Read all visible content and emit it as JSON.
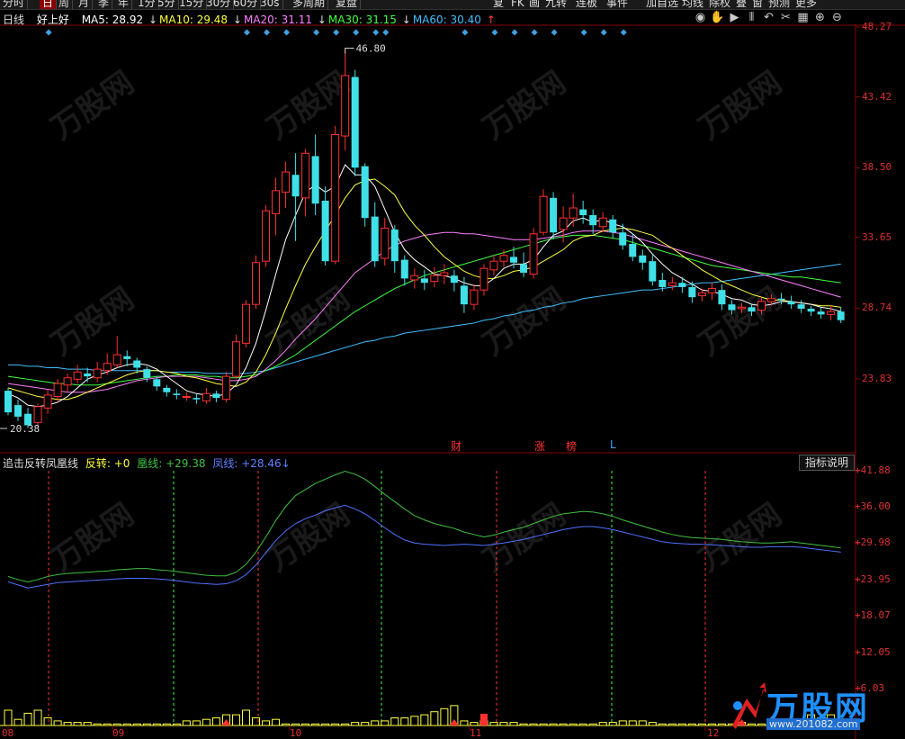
{
  "toolbar": {
    "items": [
      "分时",
      "日",
      "周",
      "月",
      "季",
      "年",
      "1分",
      "5分",
      "15分",
      "30分",
      "60分",
      "30s",
      "多周期",
      "复盘"
    ],
    "active_index": 1,
    "right_items": [
      "复",
      "FK",
      "画",
      "九转",
      "连板",
      "事件",
      "加自选",
      "均线",
      "除权",
      "叠",
      "窗",
      "预测",
      "更多"
    ]
  },
  "legend": {
    "period": "日线",
    "stock_name": "好上好",
    "ma5": "MA5: 28.92",
    "ma10": "MA10: 29.48",
    "ma20": "MA20: 31.11",
    "ma30": "MA30: 31.15",
    "ma60": "MA60: 30.40",
    "colors": {
      "ma5": "#ffffff",
      "ma10": "#ffff40",
      "ma20": "#ff80ff",
      "ma30": "#40ff40",
      "ma60": "#40c0ff"
    }
  },
  "icons": [
    "eye-icon",
    "hand-icon",
    "play-icon",
    "split-icon",
    "undo-icon",
    "scissors-icon",
    "calendar-icon",
    "zoom-in-icon",
    "zoom-out-icon"
  ],
  "price_axis": [
    "48.27",
    "43.42",
    "38.50",
    "33.65",
    "28.74",
    "23.83"
  ],
  "annotations": {
    "high": "46.80",
    "low": "20.38"
  },
  "events": [
    {
      "label": "财",
      "color": "#ff3030"
    },
    {
      "label": "涨",
      "color": "#ff3030"
    },
    {
      "label": "榜",
      "color": "#ff3030"
    },
    {
      "label": "L",
      "color": "#40a0ff"
    }
  ],
  "indicator": {
    "name": "追击反转凤凰线",
    "fanzhuan": "反转: +0",
    "huang": "凰线: +29.38",
    "feng": "凤线: +28.46",
    "button": "指标说明",
    "axis": [
      "+41.88",
      "+36.00",
      "+29.98",
      "+23.95",
      "+18.07",
      "+12.05",
      "+6.03"
    ]
  },
  "x_axis": [
    "08",
    "09",
    "10",
    "11",
    "12"
  ],
  "watermark": {
    "text": "万股网",
    "url": "www.201082.com"
  },
  "chart_data": {
    "type": "candlestick",
    "y_range": [
      20.38,
      48.27
    ],
    "high_marker": 46.8,
    "low_marker": 20.38,
    "candles": [
      [
        23.0,
        21.5,
        23.2,
        21.3
      ],
      [
        22.0,
        21.2,
        22.4,
        20.9
      ],
      [
        21.4,
        20.6,
        21.8,
        20.4
      ],
      [
        20.8,
        21.9,
        22.1,
        20.5
      ],
      [
        21.8,
        22.7,
        23.1,
        21.4
      ],
      [
        22.6,
        23.5,
        23.8,
        22.2
      ],
      [
        23.4,
        23.9,
        24.2,
        22.9
      ],
      [
        23.8,
        24.3,
        24.8,
        23.5
      ],
      [
        24.2,
        24.0,
        24.6,
        23.6
      ],
      [
        23.9,
        24.5,
        25.0,
        23.6
      ],
      [
        24.4,
        24.9,
        25.6,
        24.1
      ],
      [
        24.8,
        25.5,
        26.8,
        24.6
      ],
      [
        25.4,
        25.2,
        25.8,
        24.7
      ],
      [
        25.1,
        24.6,
        25.3,
        24.2
      ],
      [
        24.5,
        23.9,
        24.7,
        23.6
      ],
      [
        23.8,
        23.3,
        24.0,
        23.0
      ],
      [
        23.2,
        22.9,
        23.4,
        22.6
      ],
      [
        22.8,
        22.7,
        23.1,
        22.4
      ],
      [
        22.6,
        22.6,
        22.9,
        22.3
      ],
      [
        22.5,
        22.4,
        22.8,
        22.1
      ],
      [
        22.3,
        22.8,
        23.2,
        22.1
      ],
      [
        22.8,
        22.5,
        23.0,
        22.2
      ],
      [
        22.4,
        24.0,
        24.3,
        22.2
      ],
      [
        24.0,
        26.4,
        26.9,
        23.8
      ],
      [
        26.3,
        29.0,
        29.3,
        26.0
      ],
      [
        29.0,
        31.9,
        32.4,
        28.7
      ],
      [
        32.0,
        35.5,
        35.9,
        31.6
      ],
      [
        35.3,
        36.9,
        37.8,
        33.8
      ],
      [
        36.8,
        38.2,
        38.9,
        35.7
      ],
      [
        38.0,
        36.5,
        39.5,
        33.4
      ],
      [
        36.4,
        39.5,
        39.8,
        35.1
      ],
      [
        39.3,
        36.0,
        40.8,
        35.2
      ],
      [
        36.2,
        32.0,
        37.2,
        31.7
      ],
      [
        32.0,
        40.8,
        41.4,
        31.8
      ],
      [
        40.7,
        44.9,
        46.8,
        39.7
      ],
      [
        44.8,
        38.5,
        45.3,
        37.9
      ],
      [
        38.6,
        35.0,
        38.8,
        34.4
      ],
      [
        35.1,
        32.0,
        36.1,
        31.6
      ],
      [
        32.2,
        34.3,
        35.0,
        31.7
      ],
      [
        34.2,
        32.0,
        34.5,
        31.2
      ],
      [
        32.1,
        30.8,
        32.4,
        30.3
      ],
      [
        30.7,
        31.0,
        31.5,
        30.1
      ],
      [
        30.8,
        30.5,
        31.4,
        30.0
      ],
      [
        30.6,
        31.0,
        31.6,
        30.2
      ],
      [
        31.0,
        31.2,
        31.8,
        30.4
      ],
      [
        31.0,
        30.5,
        31.4,
        29.9
      ],
      [
        30.3,
        29.0,
        30.9,
        28.4
      ],
      [
        29.0,
        30.0,
        30.4,
        28.6
      ],
      [
        30.0,
        31.5,
        31.8,
        29.6
      ],
      [
        31.4,
        32.0,
        32.4,
        31.0
      ],
      [
        32.0,
        32.4,
        32.8,
        31.6
      ],
      [
        32.3,
        31.9,
        33.0,
        31.5
      ],
      [
        31.8,
        31.2,
        32.6,
        30.9
      ],
      [
        31.1,
        33.9,
        34.3,
        30.8
      ],
      [
        34.0,
        36.5,
        37.0,
        33.8
      ],
      [
        36.4,
        34.0,
        36.8,
        33.5
      ],
      [
        34.2,
        35.0,
        35.8,
        33.3
      ],
      [
        35.0,
        35.7,
        36.7,
        34.4
      ],
      [
        35.6,
        35.2,
        36.2,
        34.6
      ],
      [
        35.2,
        34.5,
        35.6,
        33.9
      ],
      [
        34.4,
        35.0,
        35.4,
        34.0
      ],
      [
        34.9,
        34.0,
        35.2,
        33.6
      ],
      [
        34.0,
        33.1,
        34.6,
        32.8
      ],
      [
        33.2,
        32.3,
        33.9,
        32.0
      ],
      [
        32.4,
        31.9,
        32.8,
        31.4
      ],
      [
        32.0,
        30.6,
        32.5,
        30.3
      ],
      [
        30.7,
        30.2,
        31.2,
        29.9
      ],
      [
        30.3,
        30.5,
        30.9,
        30.0
      ],
      [
        30.5,
        30.2,
        30.9,
        29.8
      ],
      [
        30.2,
        29.5,
        30.6,
        29.1
      ],
      [
        29.6,
        29.8,
        30.1,
        29.2
      ],
      [
        29.8,
        30.1,
        30.5,
        29.3
      ],
      [
        30.0,
        29.0,
        30.4,
        28.6
      ],
      [
        29.0,
        28.6,
        29.3,
        28.3
      ],
      [
        28.7,
        28.8,
        29.1,
        28.4
      ],
      [
        28.8,
        28.5,
        29.0,
        28.2
      ],
      [
        28.6,
        29.2,
        29.5,
        28.3
      ],
      [
        29.2,
        29.4,
        29.7,
        28.9
      ],
      [
        29.4,
        29.3,
        29.8,
        29.0
      ],
      [
        29.2,
        29.0,
        29.6,
        28.7
      ],
      [
        29.0,
        28.7,
        29.3,
        28.4
      ],
      [
        28.7,
        28.5,
        28.9,
        28.2
      ],
      [
        28.5,
        28.3,
        28.8,
        28.0
      ],
      [
        28.3,
        28.5,
        28.9,
        27.9
      ],
      [
        28.5,
        27.9,
        28.8,
        27.7
      ]
    ],
    "ma5": [
      22.8,
      22.5,
      22.0,
      21.9,
      22.0,
      22.2,
      22.6,
      23.2,
      23.8,
      24.1,
      24.3,
      24.6,
      24.8,
      24.9,
      24.8,
      24.5,
      24.0,
      23.5,
      23.0,
      22.8,
      22.7,
      22.6,
      22.8,
      23.4,
      24.6,
      26.3,
      28.6,
      31.1,
      33.5,
      35.2,
      36.8,
      37.3,
      36.8,
      37.2,
      38.7,
      38.0,
      38.0,
      37.2,
      35.6,
      34.0,
      32.8,
      32.1,
      31.6,
      31.1,
      31.0,
      30.8,
      30.5,
      30.3,
      30.3,
      30.8,
      31.5,
      31.8,
      31.8,
      32.1,
      33.0,
      33.8,
      34.1,
      34.8,
      35.0,
      34.7,
      34.9,
      34.6,
      34.4,
      33.9,
      33.3,
      32.5,
      31.8,
      31.2,
      30.8,
      30.4,
      30.0,
      29.9,
      29.7,
      29.4,
      29.3,
      29.0,
      28.9,
      29.0,
      29.2,
      29.2,
      29.1,
      29.0,
      28.8,
      28.7,
      28.5
    ],
    "ma10": [
      23.2,
      23.0,
      22.8,
      22.6,
      22.5,
      22.4,
      22.4,
      22.6,
      22.9,
      23.2,
      23.5,
      23.8,
      24.1,
      24.3,
      24.4,
      24.4,
      24.3,
      24.2,
      24.0,
      23.9,
      23.7,
      23.5,
      23.4,
      23.3,
      23.6,
      24.3,
      25.5,
      27.0,
      28.7,
      30.3,
      31.8,
      33.0,
      34.1,
      35.2,
      36.4,
      37.3,
      37.6,
      37.7,
      37.2,
      36.6,
      35.4,
      34.5,
      33.8,
      33.0,
      32.3,
      31.8,
      31.3,
      31.0,
      30.8,
      30.8,
      31.0,
      31.3,
      31.4,
      31.6,
      32.0,
      32.4,
      32.8,
      33.4,
      33.7,
      33.8,
      34.1,
      34.2,
      34.3,
      34.2,
      34.0,
      33.8,
      33.3,
      32.9,
      32.4,
      31.9,
      31.4,
      31.0,
      30.6,
      30.3,
      30.0,
      29.7,
      29.5,
      29.3,
      29.3,
      29.2,
      29.1,
      29.0,
      28.9,
      28.9,
      28.8
    ],
    "ma20": [
      23.5,
      23.4,
      23.3,
      23.2,
      23.1,
      23.0,
      22.9,
      22.9,
      22.9,
      23.0,
      23.1,
      23.3,
      23.5,
      23.7,
      23.8,
      23.9,
      24.0,
      24.0,
      24.0,
      24.0,
      23.9,
      23.8,
      23.7,
      23.7,
      23.8,
      24.0,
      24.5,
      25.1,
      25.8,
      26.6,
      27.3,
      28.0,
      28.8,
      29.6,
      30.4,
      31.2,
      31.7,
      32.2,
      32.7,
      33.1,
      33.4,
      33.6,
      33.8,
      33.9,
      34.0,
      34.0,
      33.9,
      33.9,
      33.8,
      33.7,
      33.6,
      33.5,
      33.5,
      33.5,
      33.6,
      33.7,
      33.8,
      34.0,
      34.1,
      34.1,
      34.1,
      34.0,
      33.9,
      33.7,
      33.5,
      33.3,
      33.1,
      32.9,
      32.7,
      32.5,
      32.3,
      32.1,
      31.9,
      31.7,
      31.5,
      31.3,
      31.1,
      30.9,
      30.7,
      30.5,
      30.3,
      30.1,
      29.9,
      29.7,
      29.5
    ],
    "ma30": [
      24.0,
      23.9,
      23.8,
      23.7,
      23.6,
      23.5,
      23.5,
      23.4,
      23.4,
      23.4,
      23.5,
      23.6,
      23.7,
      23.8,
      23.9,
      24.0,
      24.0,
      24.1,
      24.1,
      24.1,
      24.0,
      24.0,
      23.9,
      23.9,
      24.0,
      24.1,
      24.4,
      24.7,
      25.1,
      25.5,
      26.0,
      26.5,
      27.0,
      27.5,
      28.0,
      28.5,
      28.9,
      29.3,
      29.7,
      30.1,
      30.4,
      30.7,
      31.0,
      31.2,
      31.4,
      31.6,
      31.8,
      32.0,
      32.2,
      32.4,
      32.6,
      32.8,
      33.0,
      33.2,
      33.4,
      33.6,
      33.7,
      33.8,
      33.8,
      33.8,
      33.7,
      33.6,
      33.5,
      33.3,
      33.1,
      32.9,
      32.7,
      32.5,
      32.3,
      32.1,
      31.9,
      31.7,
      31.6,
      31.5,
      31.4,
      31.3,
      31.2,
      31.1,
      31.0,
      30.9,
      30.9,
      30.8,
      30.7,
      30.6,
      30.5
    ],
    "ma60": [
      24.8,
      24.8,
      24.7,
      24.7,
      24.6,
      24.6,
      24.5,
      24.5,
      24.5,
      24.4,
      24.4,
      24.4,
      24.4,
      24.4,
      24.4,
      24.4,
      24.3,
      24.3,
      24.3,
      24.3,
      24.2,
      24.2,
      24.2,
      24.2,
      24.2,
      24.3,
      24.4,
      24.6,
      24.8,
      25.0,
      25.2,
      25.4,
      25.6,
      25.8,
      26.0,
      26.2,
      26.4,
      26.5,
      26.7,
      26.8,
      27.0,
      27.1,
      27.2,
      27.3,
      27.4,
      27.5,
      27.6,
      27.7,
      27.9,
      28.0,
      28.2,
      28.3,
      28.5,
      28.6,
      28.8,
      28.9,
      29.1,
      29.2,
      29.4,
      29.5,
      29.6,
      29.7,
      29.8,
      29.9,
      30.0,
      30.0,
      30.1,
      30.2,
      30.3,
      30.4,
      30.5,
      30.5,
      30.6,
      30.7,
      30.8,
      30.9,
      31.0,
      31.1,
      31.2,
      31.3,
      31.4,
      31.5,
      31.6,
      31.7,
      31.8
    ],
    "indicator": {
      "y_range": [
        0,
        41.88
      ],
      "huang": [
        24.5,
        24.0,
        23.6,
        24.0,
        24.5,
        24.8,
        25.0,
        25.1,
        25.2,
        25.3,
        25.4,
        25.6,
        25.7,
        25.8,
        25.8,
        25.6,
        25.5,
        25.3,
        25.1,
        24.9,
        24.7,
        24.6,
        24.6,
        25.2,
        26.5,
        28.5,
        31.0,
        33.7,
        36.0,
        37.8,
        38.8,
        39.8,
        40.5,
        41.2,
        41.8,
        41.3,
        40.5,
        39.3,
        38.0,
        36.8,
        35.6,
        34.5,
        33.8,
        33.2,
        32.8,
        32.4,
        31.8,
        31.4,
        31.0,
        31.3,
        31.8,
        32.2,
        32.6,
        33.2,
        33.8,
        34.4,
        34.8,
        35.0,
        35.2,
        35.1,
        34.8,
        34.4,
        33.8,
        33.3,
        32.8,
        32.3,
        31.8,
        31.4,
        31.1,
        30.9,
        30.8,
        30.7,
        30.6,
        30.4,
        30.2,
        30.1,
        30.0,
        30.0,
        30.1,
        30.2,
        30.0,
        29.8,
        29.6,
        29.4,
        29.2
      ],
      "feng": [
        23.6,
        23.1,
        22.6,
        22.9,
        23.2,
        23.5,
        23.6,
        23.7,
        23.8,
        23.9,
        24.0,
        24.1,
        24.2,
        24.2,
        24.2,
        24.1,
        24.0,
        23.8,
        23.6,
        23.4,
        23.3,
        23.2,
        23.3,
        23.8,
        24.8,
        26.4,
        28.4,
        30.4,
        32.0,
        33.2,
        34.0,
        34.6,
        35.3,
        35.8,
        36.2,
        35.6,
        34.8,
        33.7,
        32.5,
        31.4,
        30.5,
        30.0,
        29.8,
        29.7,
        29.6,
        29.7,
        29.8,
        29.7,
        29.6,
        29.8,
        30.0,
        30.3,
        30.6,
        31.0,
        31.4,
        31.8,
        32.2,
        32.5,
        32.7,
        32.7,
        32.5,
        32.2,
        31.8,
        31.4,
        31.0,
        30.6,
        30.2,
        30.0,
        29.9,
        29.8,
        29.8,
        29.7,
        29.6,
        29.5,
        29.4,
        29.3,
        29.3,
        29.4,
        29.4,
        29.4,
        29.3,
        29.1,
        28.9,
        28.7,
        28.5
      ],
      "volume": [
        10,
        4,
        8,
        10,
        5,
        3,
        2,
        2,
        2,
        1,
        1,
        1,
        1,
        1,
        1,
        1,
        1,
        1,
        3,
        3,
        4,
        5,
        7,
        7,
        10,
        5,
        3,
        4,
        1,
        1,
        1,
        1,
        1,
        1,
        1,
        2,
        2,
        3,
        3,
        5,
        5,
        6,
        7,
        9,
        11,
        13,
        3,
        2,
        3,
        2,
        2,
        2,
        1,
        1,
        1,
        1,
        1,
        1,
        1,
        1,
        2,
        2,
        3,
        3,
        3,
        2,
        1,
        1,
        1,
        1,
        1,
        1,
        1,
        1,
        2,
        1,
        1,
        2,
        2,
        4,
        4,
        7,
        5,
        7,
        4
      ]
    },
    "signals": [
      {
        "index": 22,
        "type": "red-triangle"
      },
      {
        "index": 45,
        "type": "red-triangle"
      },
      {
        "index": 74,
        "type": "red-triangle"
      }
    ]
  }
}
